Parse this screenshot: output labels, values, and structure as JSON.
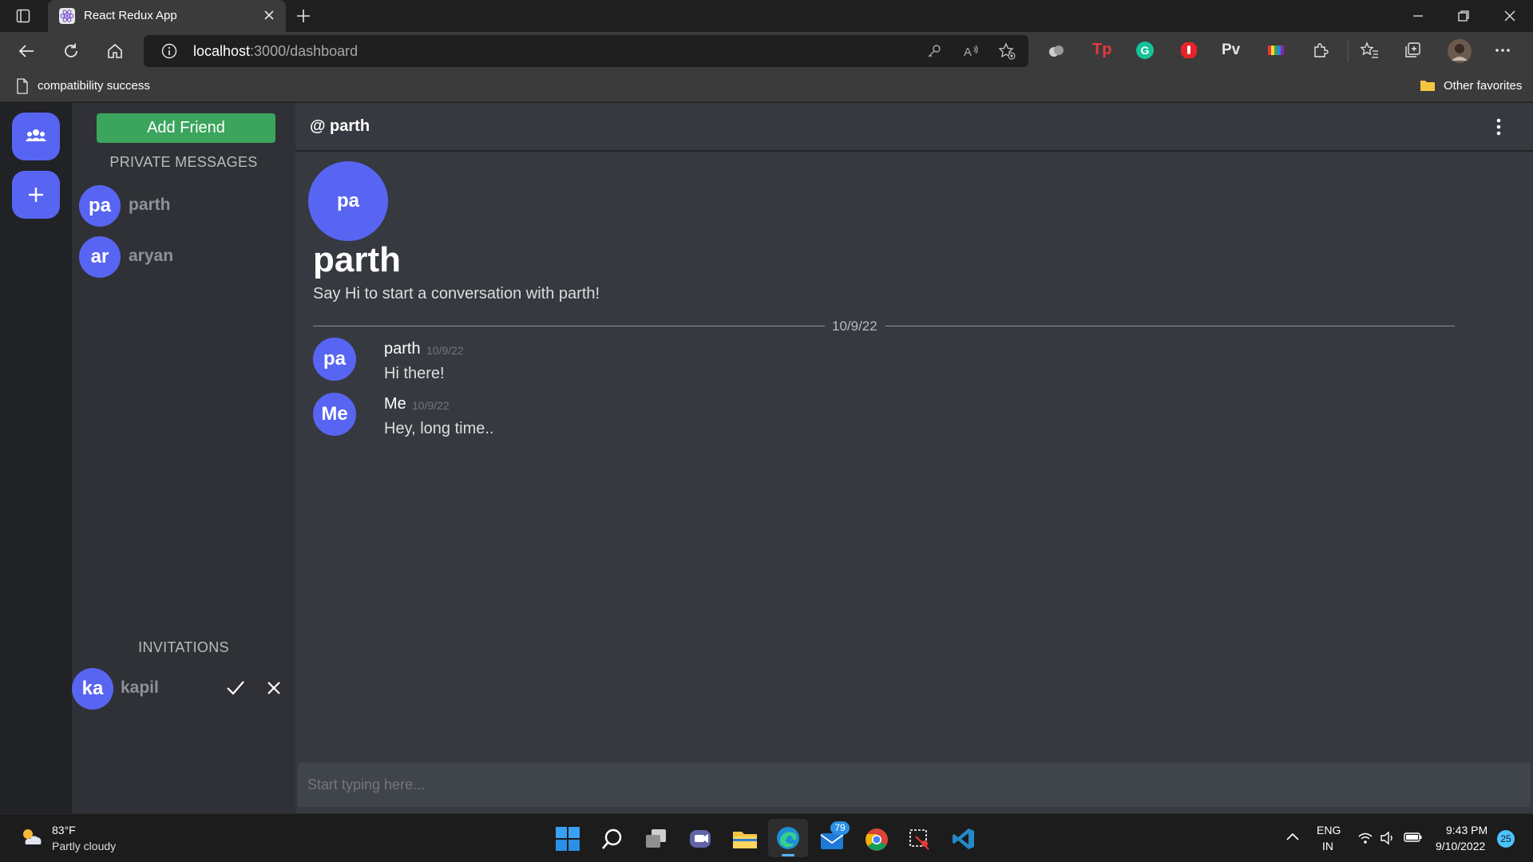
{
  "browser": {
    "tab_title": "React Redux App",
    "url_host": "localhost",
    "url_rest": ":3000/dashboard",
    "favorites_item": "compatibility success",
    "other_favorites": "Other favorites",
    "extension_pv": "Pv",
    "extension_tp": "Tp"
  },
  "sidebar": {
    "add_friend_label": "Add Friend",
    "private_messages_label": "PRIVATE MESSAGES",
    "friends": [
      {
        "initials": "pa",
        "name": "parth"
      },
      {
        "initials": "ar",
        "name": "aryan"
      }
    ],
    "invitations_label": "INVITATIONS",
    "invitations": [
      {
        "initials": "ka",
        "name": "kapil"
      }
    ]
  },
  "chat": {
    "header_title": "@ parth",
    "recipient_initials": "pa",
    "recipient_name": "parth",
    "intro_text": "Say Hi to start a conversation with parth!",
    "divider_date": "10/9/22",
    "messages": [
      {
        "initials": "pa",
        "author": "parth",
        "date": "10/9/22",
        "text": "Hi there!"
      },
      {
        "initials": "Me",
        "author": "Me",
        "date": "10/9/22",
        "text": "Hey, long time.."
      }
    ],
    "input_placeholder": "Start typing here..."
  },
  "taskbar": {
    "weather_temp": "83°F",
    "weather_desc": "Partly cloudy",
    "mail_badge": "79",
    "lang_line1": "ENG",
    "lang_line2": "IN",
    "time": "9:43 PM",
    "date": "9/10/2022",
    "notification_count": "25"
  },
  "colors": {
    "accent": "#5865f2",
    "add_friend_green": "#3ba55d",
    "main_bg": "#36393f",
    "sidebar_bg": "#2f3136",
    "rail_bg": "#202225"
  }
}
